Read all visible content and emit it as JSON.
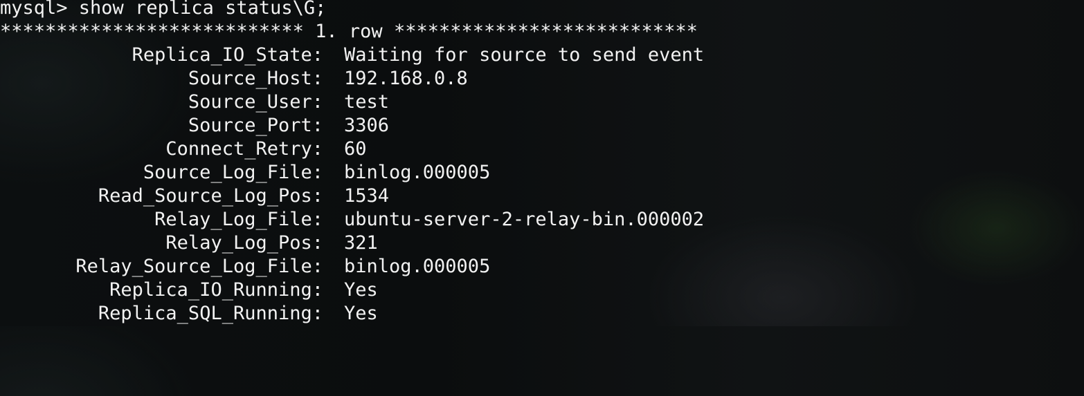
{
  "terminal": {
    "command_line": "mysql> show replica status\\G;",
    "row_separator": "*************************** 1. row ***************************",
    "fields": [
      {
        "label": "Replica_IO_State:",
        "value": "Waiting for source to send event"
      },
      {
        "label": "Source_Host:",
        "value": "192.168.0.8"
      },
      {
        "label": "Source_User:",
        "value": "test"
      },
      {
        "label": "Source_Port:",
        "value": "3306"
      },
      {
        "label": "Connect_Retry:",
        "value": "60"
      },
      {
        "label": "Source_Log_File:",
        "value": "binlog.000005"
      },
      {
        "label": "Read_Source_Log_Pos:",
        "value": "1534"
      },
      {
        "label": "Relay_Log_File:",
        "value": "ubuntu-server-2-relay-bin.000002"
      },
      {
        "label": "Relay_Log_Pos:",
        "value": "321"
      },
      {
        "label": "Relay_Source_Log_File:",
        "value": "binlog.000005"
      },
      {
        "label": "Replica_IO_Running:",
        "value": "Yes"
      },
      {
        "label": "Replica_SQL_Running:",
        "value": "Yes"
      }
    ]
  }
}
